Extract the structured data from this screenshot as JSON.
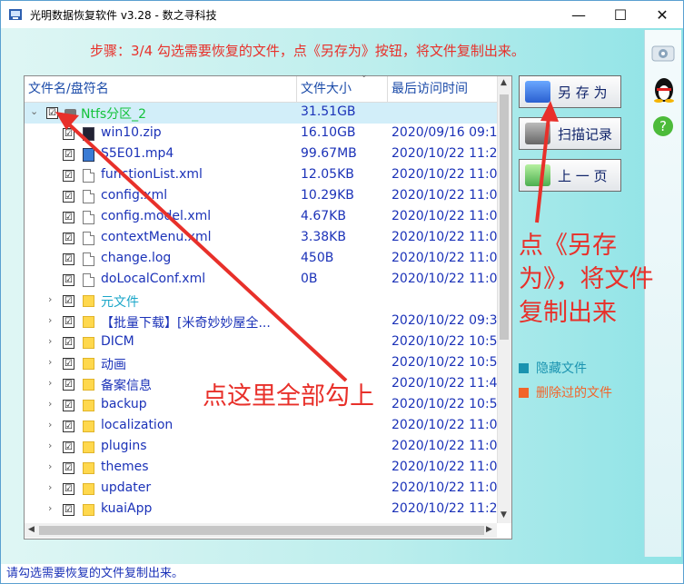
{
  "window": {
    "title": "光明数据恢复软件 v3.28 - 数之寻科技",
    "controls": {
      "minimize": "—",
      "maximize": "☐",
      "close": "✕"
    }
  },
  "step_text": "步骤：3/4 勾选需要恢复的文件，点《另存为》按钮，将文件复制出来。",
  "columns": {
    "name": "文件名/盘符名",
    "size": "文件大小",
    "time": "最后访问时间"
  },
  "root": {
    "name": "Ntfs分区_2",
    "size": "31.51GB",
    "checked": "☑",
    "expander": "⌄"
  },
  "files": [
    {
      "name": "win10.zip",
      "size": "16.10GB",
      "time": "2020/09/16 09:1",
      "icon": "zip-icon"
    },
    {
      "name": "S5E01.mp4",
      "size": "99.67MB",
      "time": "2020/10/22 11:2",
      "icon": "video-file-icon"
    },
    {
      "name": "functionList.xml",
      "size": "12.05KB",
      "time": "2020/10/22 11:0",
      "icon": "file-icon"
    },
    {
      "name": "config.xml",
      "size": "10.29KB",
      "time": "2020/10/22 11:0",
      "icon": "file-icon"
    },
    {
      "name": "config.model.xml",
      "size": "4.67KB",
      "time": "2020/10/22 11:0",
      "icon": "file-icon"
    },
    {
      "name": "contextMenu.xml",
      "size": "3.38KB",
      "time": "2020/10/22 11:0",
      "icon": "file-icon"
    },
    {
      "name": "change.log",
      "size": "450B",
      "time": "2020/10/22 11:0",
      "icon": "file-icon"
    },
    {
      "name": "doLocalConf.xml",
      "size": "0B",
      "time": "2020/10/22 11:0",
      "icon": "file-icon"
    }
  ],
  "folders": [
    {
      "name": "元文件",
      "time": "",
      "color": "cyan"
    },
    {
      "name": "【批量下载】[米奇妙妙屋全...",
      "time": "2020/10/22 09:3",
      "color": "blue"
    },
    {
      "name": "DICM",
      "time": "2020/10/22 10:5",
      "color": "blue"
    },
    {
      "name": "动画",
      "time": "2020/10/22 10:5",
      "color": "blue"
    },
    {
      "name": "备案信息",
      "time": "2020/10/22 11:4",
      "color": "blue"
    },
    {
      "name": "backup",
      "time": "2020/10/22 10:5",
      "color": "blue"
    },
    {
      "name": "localization",
      "time": "2020/10/22 11:0",
      "color": "blue"
    },
    {
      "name": "plugins",
      "time": "2020/10/22 11:0",
      "color": "blue"
    },
    {
      "name": "themes",
      "time": "2020/10/22 11:0",
      "color": "blue"
    },
    {
      "name": "updater",
      "time": "2020/10/22 11:0",
      "color": "blue"
    },
    {
      "name": "kuaiApp",
      "time": "2020/10/22 11:2",
      "color": "blue"
    }
  ],
  "buttons": {
    "save_as": "另 存 为",
    "scan_record": "扫描记录",
    "prev_page": "上 一 页"
  },
  "legend": {
    "hidden": "隐藏文件",
    "deleted": "删除过的文件"
  },
  "status_bar": "请勾选需要恢复的文件复制出来。",
  "annotations": {
    "check_all": "点这里全部勾上",
    "save_hint_lines": [
      "点《另存",
      "为》，将文件",
      "复制出来"
    ]
  },
  "colors": {
    "accent_red": "#e8302a",
    "hidden_legend": "#1a93b0",
    "deleted_legend": "#f2642a",
    "text_blue": "#1b32b8",
    "root_green": "#13c23a",
    "folder_cyan": "#1aa6c8"
  }
}
